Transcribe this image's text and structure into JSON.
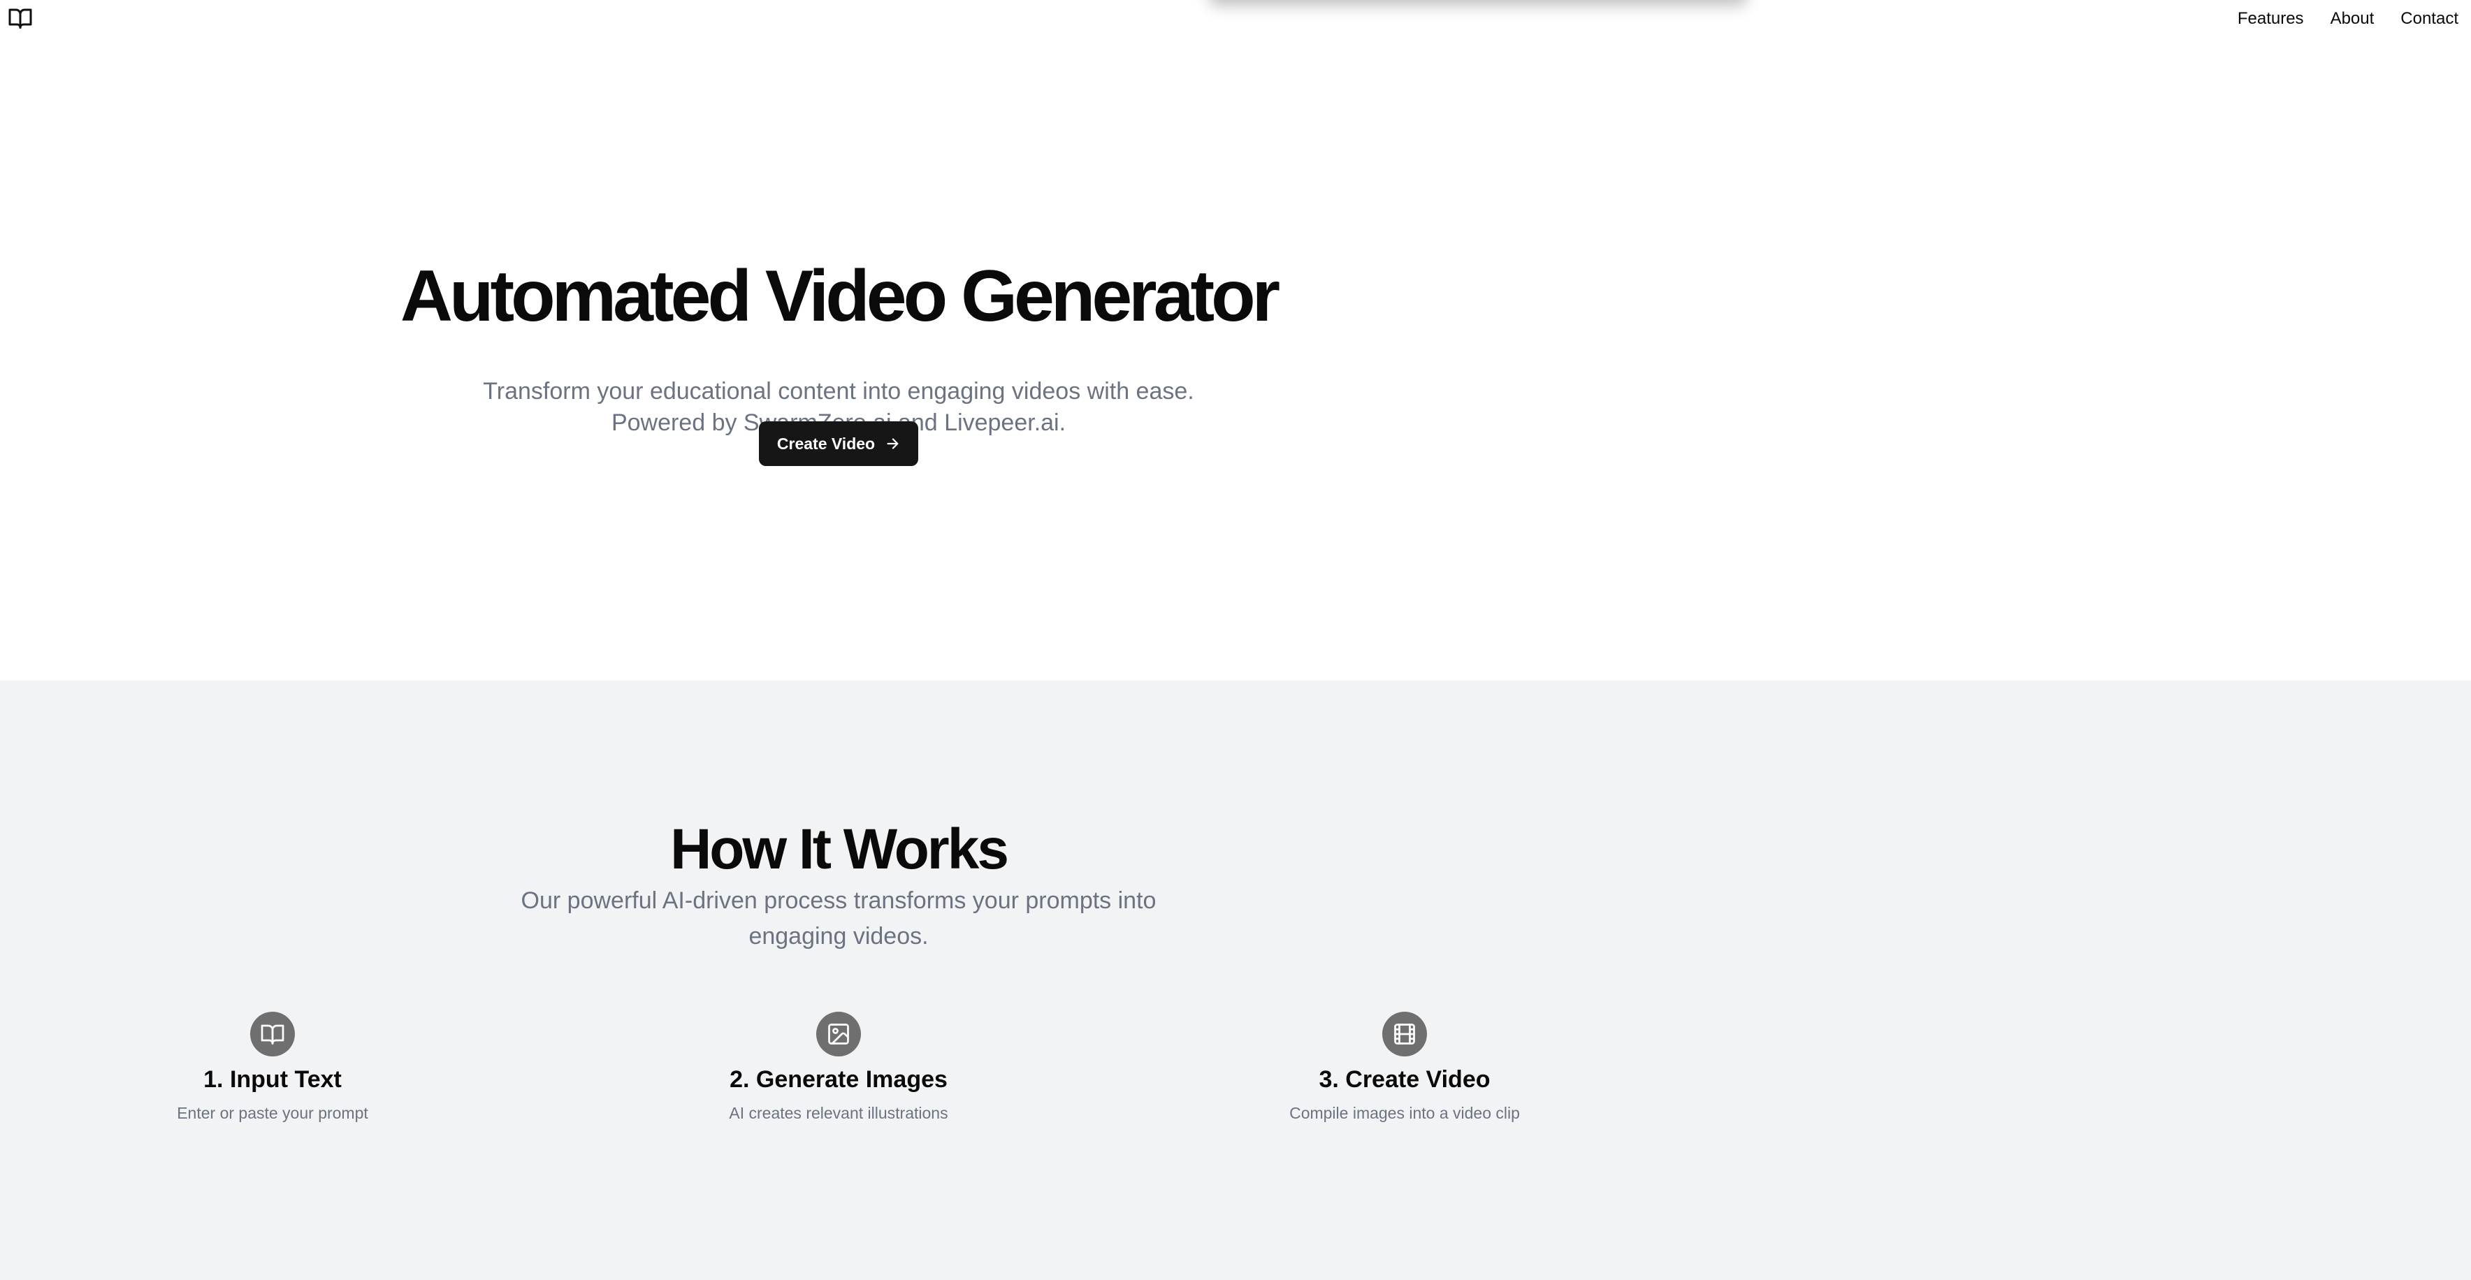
{
  "header": {
    "logo_icon": "open-book-icon",
    "nav": [
      {
        "label": "Features"
      },
      {
        "label": "About"
      },
      {
        "label": "Contact"
      }
    ]
  },
  "hero": {
    "title": "Automated Video Generator",
    "subtitle_line1": "Transform your educational content into engaging videos with ease.",
    "subtitle_line2": "Powered by SwarmZero.ai and Livepeer.ai.",
    "cta_label": "Create Video",
    "cta_icon": "arrow-right-icon",
    "cta_color": "#161616"
  },
  "how": {
    "title": "How It Works",
    "subtitle_line1": "Our powerful AI-driven process transforms your prompts into",
    "subtitle_line2": "engaging videos.",
    "background": "#f2f3f5",
    "steps": [
      {
        "icon": "open-book-icon",
        "title": "1. Input Text",
        "description": "Enter or paste your prompt"
      },
      {
        "icon": "image-icon",
        "title": "2. Generate Images",
        "description": "AI creates relevant illustrations"
      },
      {
        "icon": "film-icon",
        "title": "3. Create Video",
        "description": "Compile images into a video clip"
      }
    ]
  }
}
